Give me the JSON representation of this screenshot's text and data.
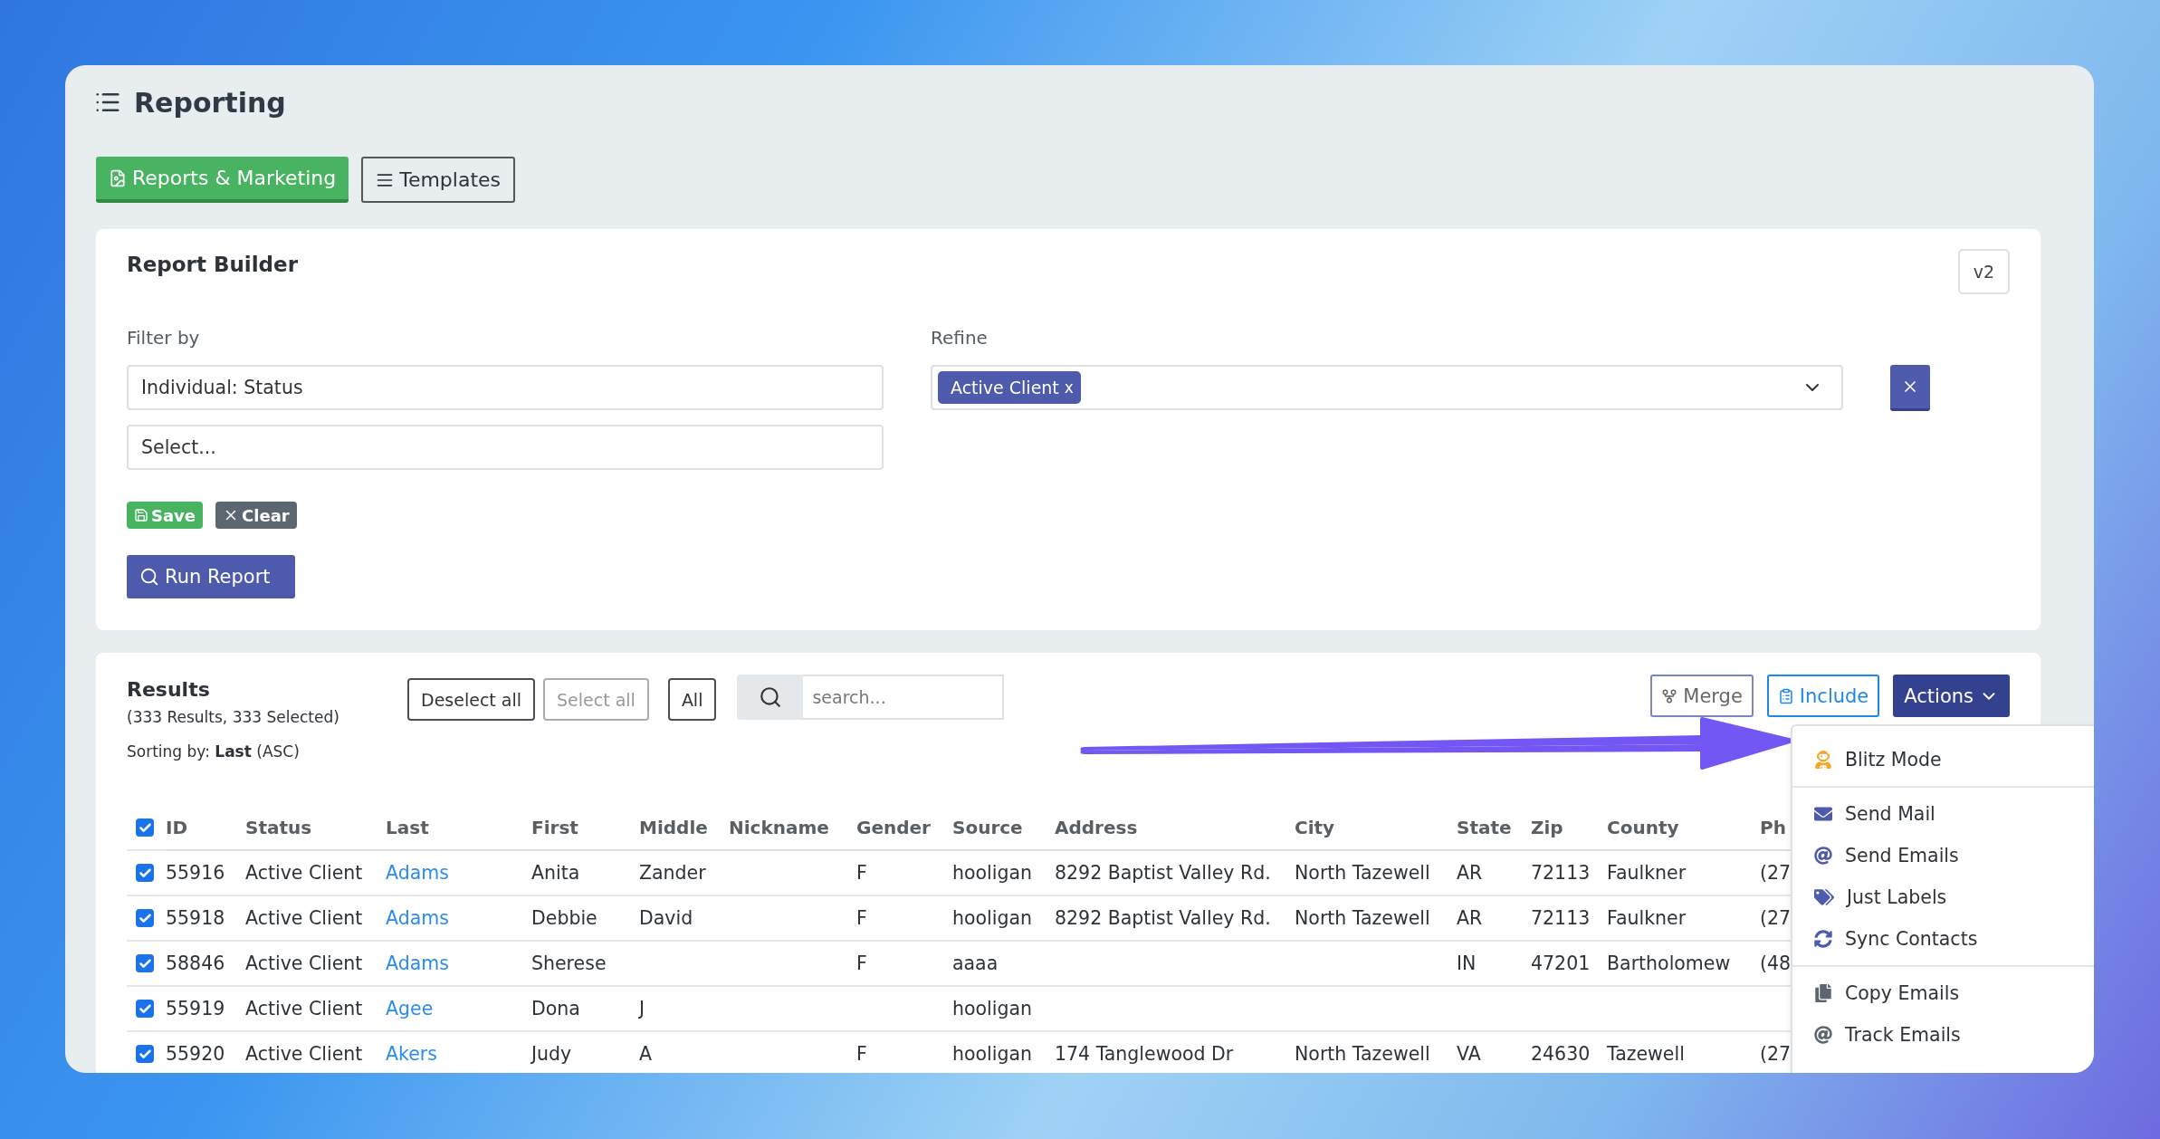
{
  "page": {
    "title": "Reporting"
  },
  "tabs": [
    {
      "label": "Reports & Marketing",
      "selected": true
    },
    {
      "label": "Templates",
      "selected": false
    }
  ],
  "report_builder": {
    "title": "Report Builder",
    "version": "v2",
    "filter_label": "Filter by",
    "filter_value": "Individual: Status",
    "filter_placeholder": "Select...",
    "refine_label": "Refine",
    "refine_tags": [
      {
        "label": "Active Client",
        "remove": "x"
      }
    ],
    "save": "Save",
    "clear": "Clear",
    "run": "Run Report"
  },
  "results": {
    "title": "Results",
    "count": "(333 Results, 333 Selected)",
    "sorting": "Sorting by: **Last** (ASC)",
    "selection_buttons": [
      {
        "label": "Deselect all",
        "disabled": false
      },
      {
        "label": "Select all",
        "disabled": true
      },
      {
        "label": "All",
        "disabled": false
      }
    ],
    "search": {
      "placeholder": "search..."
    },
    "merge": "Merge",
    "include": "Include",
    "actions": "Actions",
    "table": {
      "all_selected": true,
      "columns": [
        {
          "label": "ID",
          "kind": "text"
        },
        {
          "label": "Status",
          "kind": "text"
        },
        {
          "label": "Last",
          "kind": "link"
        },
        {
          "label": "First",
          "kind": "text"
        },
        {
          "label": "Middle",
          "kind": "text"
        },
        {
          "label": "Nickname",
          "kind": "text"
        },
        {
          "label": "Gender",
          "kind": "text"
        },
        {
          "label": "Source",
          "kind": "text"
        },
        {
          "label": "Address",
          "kind": "text"
        },
        {
          "label": "City",
          "kind": "text"
        },
        {
          "label": "State",
          "kind": "text"
        },
        {
          "label": "Zip",
          "kind": "text"
        },
        {
          "label": "County",
          "kind": "text"
        },
        {
          "label": "Ph",
          "kind": "text"
        }
      ],
      "rows": [
        {
          "selected": true,
          "cells": [
            "55916",
            "Active Client",
            "Adams",
            "Anita",
            "Zander",
            null,
            "F",
            "hooligan",
            "8292 Baptist Valley Rd.",
            "North Tazewell",
            "AR",
            "72113",
            "Faulkner",
            "(27"
          ]
        },
        {
          "selected": true,
          "cells": [
            "55918",
            "Active Client",
            "Adams",
            "Debbie",
            "David",
            null,
            "F",
            "hooligan",
            "8292 Baptist Valley Rd.",
            "North Tazewell",
            "AR",
            "72113",
            "Faulkner",
            "(27"
          ]
        },
        {
          "selected": true,
          "cells": [
            "58846",
            "Active Client",
            "Adams",
            "Sherese",
            null,
            null,
            "F",
            "aaaa",
            null,
            null,
            "IN",
            "47201",
            "Bartholomew",
            "(48"
          ]
        },
        {
          "selected": true,
          "cells": [
            "55919",
            "Active Client",
            "Agee",
            "Dona",
            "J",
            null,
            null,
            "hooligan",
            null,
            null,
            null,
            null,
            null,
            null
          ]
        },
        {
          "selected": true,
          "cells": [
            "55920",
            "Active Client",
            "Akers",
            "Judy",
            "A",
            null,
            "F",
            "hooligan",
            "174 Tanglewood Dr",
            "North Tazewell",
            "VA",
            "24630",
            "Tazewell",
            "(27"
          ]
        }
      ]
    }
  },
  "actions_menu": {
    "sections": [
      [
        {
          "label": "Blitz Mode"
        }
      ],
      [
        {
          "label": "Send Mail"
        },
        {
          "label": "Send Emails"
        },
        {
          "label": "Just Labels"
        },
        {
          "label": "Sync Contacts"
        }
      ],
      [
        {
          "label": "Copy Emails"
        },
        {
          "label": "Track Emails"
        }
      ]
    ]
  }
}
